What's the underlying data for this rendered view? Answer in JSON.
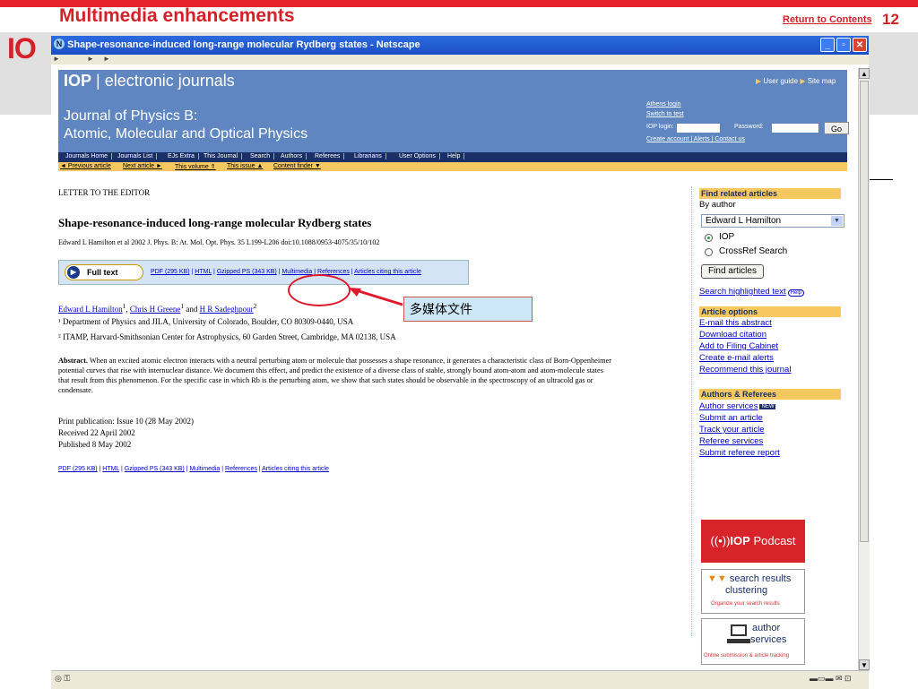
{
  "slide": {
    "title": "Multimedia enhancements",
    "return_link": "Return to Contents",
    "page_number": "12",
    "logo": "IO"
  },
  "window": {
    "title": "Shape-resonance-induced long-range molecular Rydberg states - Netscape",
    "min_btn": "_",
    "max_btn": "▫",
    "close_btn": "✕"
  },
  "header": {
    "logo_iop": "IOP",
    "logo_text": "electronic journals",
    "user_guide": "User guide",
    "site_map": "Site map",
    "journal_line1": "Journal of Physics B:",
    "journal_line2": "Atomic, Molecular and Optical Physics",
    "athens_login": "Athens login",
    "switch_to_test": "Switch to test",
    "iop_login_label": "IOP login:",
    "password_label": "Password:",
    "go_button": "Go",
    "account_links": "Create account | Alerts | Contact us"
  },
  "menu": [
    "Journals Home",
    "Journals List",
    "EJs Extra",
    "This Journal",
    "Search",
    "Authors",
    "Referees",
    "Librarians",
    "User Options",
    "Help"
  ],
  "subnav": {
    "prev": "◄ Previous article",
    "next": "Next article ►",
    "volume": "This volume ⇑",
    "issue": "This issue ▲",
    "finder": "Content finder ▼"
  },
  "article": {
    "section": "LETTER TO THE EDITOR",
    "title": "Shape-resonance-induced long-range molecular Rydberg states",
    "citation": "Edward L Hamilton et al 2002 J. Phys. B: At. Mol. Opt. Phys. 35 L199-L206   doi:10.1088/0953-4075/35/10/102",
    "full_text": "Full text",
    "links": [
      "PDF (295 KB)",
      "HTML",
      "Gzipped PS (343 KB)",
      "Multimedia",
      "References",
      "Articles citing this article"
    ],
    "author1": "Edward L Hamilton",
    "author2": "Chris H Greene",
    "author3": "H R Sadeghpour",
    "and": "and",
    "affil1": "¹ Department of Physics and JILA, University of Colorado, Boulder, CO 80309-0440, USA",
    "affil2": "² ITAMP, Harvard-Smithsonian Center for Astrophysics, 60 Garden Street, Cambridge, MA 02138, USA",
    "abstract_label": "Abstract.",
    "abstract": "When an excited atomic electron interacts with a neutral perturbing atom or molecule that possesses a shape resonance, it generates a characteristic class of Born-Oppenheimer potential curves that rise with internuclear distance. We document this effect, and predict the existence of a diverse class of stable, strongly bound atom-atom and atom-molecule states that result from this phenomenon. For the specific case in which Rb is the perturbing atom, we show that such states should be observable in the spectroscopy of an ultracold gas or condensate.",
    "print_pub": "Print publication: Issue 10 (28 May 2002)",
    "received": "Received 22 April 2002",
    "published": "Published 8 May 2002"
  },
  "callout": "多媒体文件",
  "sidebar": {
    "find_related": "Find related articles",
    "by_author": "By author",
    "author_select": "Edward L Hamilton",
    "radio_iop": "IOP",
    "radio_crossref": "CrossRef Search",
    "find_button": "Find articles",
    "search_highlighted": "Search highlighted text",
    "help": "Help",
    "article_options": "Article options",
    "options": [
      "E-mail this abstract",
      "Download citation",
      "Add to Filing Cabinet",
      "Create e-mail alerts",
      "Recommend this journal"
    ],
    "authors_referees": "Authors & Referees",
    "author_services": "Author services",
    "new_badge": "NEW",
    "ar_links": [
      "Submit an article",
      "Track your article",
      "Referee services",
      "Submit referee report"
    ],
    "podcast_iop": "IOP",
    "podcast_word": "Podcast",
    "cluster_l1": "search results",
    "cluster_l2": "clustering",
    "cluster_l3": "Organize your search results",
    "authsvc_l1": "author",
    "authsvc_l2": "services",
    "authsvc_l3": "Online submission & article tracking"
  }
}
